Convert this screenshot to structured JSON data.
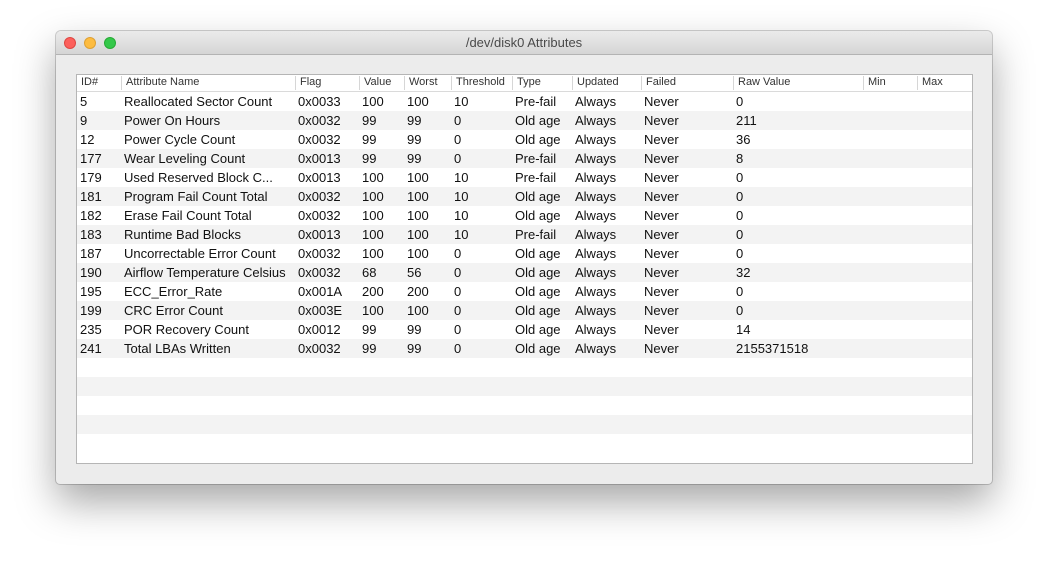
{
  "window": {
    "title": "/dev/disk0 Attributes"
  },
  "table": {
    "columns": [
      "ID#",
      "Attribute Name",
      "Flag",
      "Value",
      "Worst",
      "Threshold",
      "Type",
      "Updated",
      "Failed",
      "Raw Value",
      "Min",
      "Max"
    ],
    "rows": [
      {
        "id": "5",
        "name": "Reallocated Sector Count",
        "flag": "0x0033",
        "value": "100",
        "worst": "100",
        "threshold": "10",
        "type": "Pre-fail",
        "updated": "Always",
        "failed": "Never",
        "raw": "0",
        "min": "",
        "max": ""
      },
      {
        "id": "9",
        "name": "Power On Hours",
        "flag": "0x0032",
        "value": "99",
        "worst": "99",
        "threshold": "0",
        "type": "Old age",
        "updated": "Always",
        "failed": "Never",
        "raw": "211",
        "min": "",
        "max": ""
      },
      {
        "id": "12",
        "name": "Power Cycle Count",
        "flag": "0x0032",
        "value": "99",
        "worst": "99",
        "threshold": "0",
        "type": "Old age",
        "updated": "Always",
        "failed": "Never",
        "raw": "36",
        "min": "",
        "max": ""
      },
      {
        "id": "177",
        "name": "Wear Leveling Count",
        "flag": "0x0013",
        "value": "99",
        "worst": "99",
        "threshold": "0",
        "type": "Pre-fail",
        "updated": "Always",
        "failed": "Never",
        "raw": "8",
        "min": "",
        "max": ""
      },
      {
        "id": "179",
        "name": "Used Reserved Block C...",
        "flag": "0x0013",
        "value": "100",
        "worst": "100",
        "threshold": "10",
        "type": "Pre-fail",
        "updated": "Always",
        "failed": "Never",
        "raw": "0",
        "min": "",
        "max": ""
      },
      {
        "id": "181",
        "name": "Program Fail Count Total",
        "flag": "0x0032",
        "value": "100",
        "worst": "100",
        "threshold": "10",
        "type": "Old age",
        "updated": "Always",
        "failed": "Never",
        "raw": "0",
        "min": "",
        "max": ""
      },
      {
        "id": "182",
        "name": "Erase Fail Count Total",
        "flag": "0x0032",
        "value": "100",
        "worst": "100",
        "threshold": "10",
        "type": "Old age",
        "updated": "Always",
        "failed": "Never",
        "raw": "0",
        "min": "",
        "max": ""
      },
      {
        "id": "183",
        "name": "Runtime Bad Blocks",
        "flag": "0x0013",
        "value": "100",
        "worst": "100",
        "threshold": "10",
        "type": "Pre-fail",
        "updated": "Always",
        "failed": "Never",
        "raw": "0",
        "min": "",
        "max": ""
      },
      {
        "id": "187",
        "name": "Uncorrectable Error Count",
        "flag": "0x0032",
        "value": "100",
        "worst": "100",
        "threshold": "0",
        "type": "Old age",
        "updated": "Always",
        "failed": "Never",
        "raw": "0",
        "min": "",
        "max": ""
      },
      {
        "id": "190",
        "name": "Airflow Temperature Celsius",
        "flag": "0x0032",
        "value": "68",
        "worst": "56",
        "threshold": "0",
        "type": "Old age",
        "updated": "Always",
        "failed": "Never",
        "raw": "32",
        "min": "",
        "max": ""
      },
      {
        "id": "195",
        "name": "ECC_Error_Rate",
        "flag": "0x001A",
        "value": "200",
        "worst": "200",
        "threshold": "0",
        "type": "Old age",
        "updated": "Always",
        "failed": "Never",
        "raw": "0",
        "min": "",
        "max": ""
      },
      {
        "id": "199",
        "name": "CRC Error Count",
        "flag": "0x003E",
        "value": "100",
        "worst": "100",
        "threshold": "0",
        "type": "Old age",
        "updated": "Always",
        "failed": "Never",
        "raw": "0",
        "min": "",
        "max": ""
      },
      {
        "id": "235",
        "name": "POR Recovery Count",
        "flag": "0x0012",
        "value": "99",
        "worst": "99",
        "threshold": "0",
        "type": "Old age",
        "updated": "Always",
        "failed": "Never",
        "raw": "14",
        "min": "",
        "max": ""
      },
      {
        "id": "241",
        "name": "Total LBAs Written",
        "flag": "0x0032",
        "value": "99",
        "worst": "99",
        "threshold": "0",
        "type": "Old age",
        "updated": "Always",
        "failed": "Never",
        "raw": "2155371518",
        "min": "",
        "max": ""
      }
    ]
  },
  "colors": {
    "alt_row": "#f3f3f3",
    "close_button": "#fc605c",
    "minimize_button": "#fdbc40",
    "zoom_button": "#34c84a"
  }
}
